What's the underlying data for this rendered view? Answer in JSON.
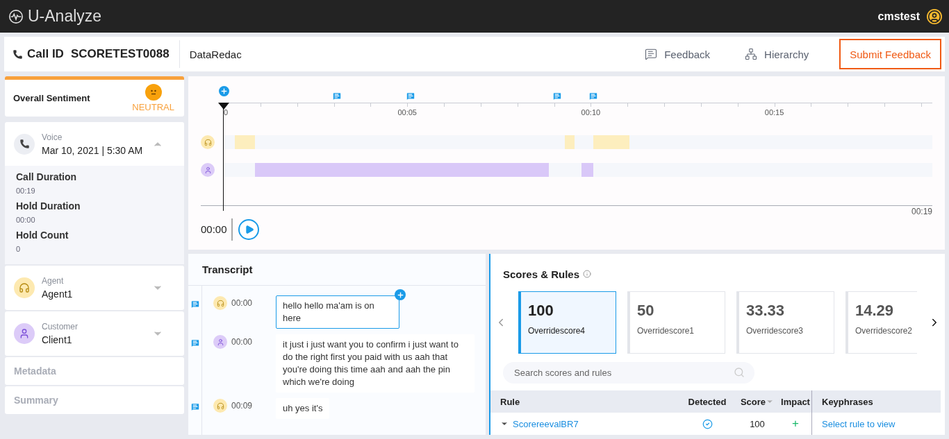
{
  "app": {
    "name": "U-Analyze",
    "user": "cmstest"
  },
  "header": {
    "call_id_label": "Call ID",
    "call_id": "SCORETEST0088",
    "source": "DataRedac",
    "actions": [
      "Feedback",
      "Hierarchy"
    ],
    "submit": "Submit Feedback"
  },
  "sentiment": {
    "label": "Overall Sentiment",
    "value": "NEUTRAL"
  },
  "voice": {
    "label": "Voice",
    "date": "Mar 10, 2021 | 5:30 AM",
    "expanded": true,
    "stats": [
      {
        "label": "Call Duration",
        "value": "00:19"
      },
      {
        "label": "Hold Duration",
        "value": "00:00"
      },
      {
        "label": "Hold Count",
        "value": "0"
      }
    ]
  },
  "parties": [
    {
      "kind": "agent",
      "label": "Agent",
      "name": "Agent1",
      "expanded": false
    },
    {
      "kind": "customer",
      "label": "Customer",
      "name": "Client1",
      "expanded": false
    }
  ],
  "sections": [
    {
      "label": "Metadata",
      "disabled": true
    },
    {
      "label": "Summary",
      "disabled": true
    }
  ],
  "timeline": {
    "ticks": [
      "0",
      "00:05",
      "00:10",
      "00:15"
    ],
    "end": "00:19",
    "current": "00:00"
  },
  "transcript": {
    "title": "Transcript",
    "entries": [
      {
        "kind": "agent",
        "time": "00:00",
        "text": "hello hello ma'am is on here",
        "selected": true
      },
      {
        "kind": "customer",
        "time": "00:00",
        "text": "it just i just want you to confirm i just want to do the right first you paid with us aah that you're doing this time aah and aah the pin which we're doing",
        "selected": false
      },
      {
        "kind": "agent",
        "time": "00:09",
        "text": "uh yes it's",
        "selected": false
      }
    ]
  },
  "scores": {
    "title": "Scores & Rules",
    "cards": [
      {
        "value": "100",
        "name": "Overridescore4",
        "selected": true
      },
      {
        "value": "50",
        "name": "Overridescore1",
        "selected": false
      },
      {
        "value": "33.33",
        "name": "Overridescore3",
        "selected": false
      },
      {
        "value": "14.29",
        "name": "Overridescore2",
        "selected": false
      }
    ],
    "search_placeholder": "Search scores and rules",
    "columns": [
      "Rule",
      "Detected",
      "Score",
      "Impact",
      "Keyphrases"
    ],
    "rows": [
      {
        "rule": "ScorereevalBR7",
        "detected": true,
        "score": "100",
        "impact": "+",
        "expanded": true
      }
    ],
    "keyphrases_hint": "Select rule to view"
  }
}
